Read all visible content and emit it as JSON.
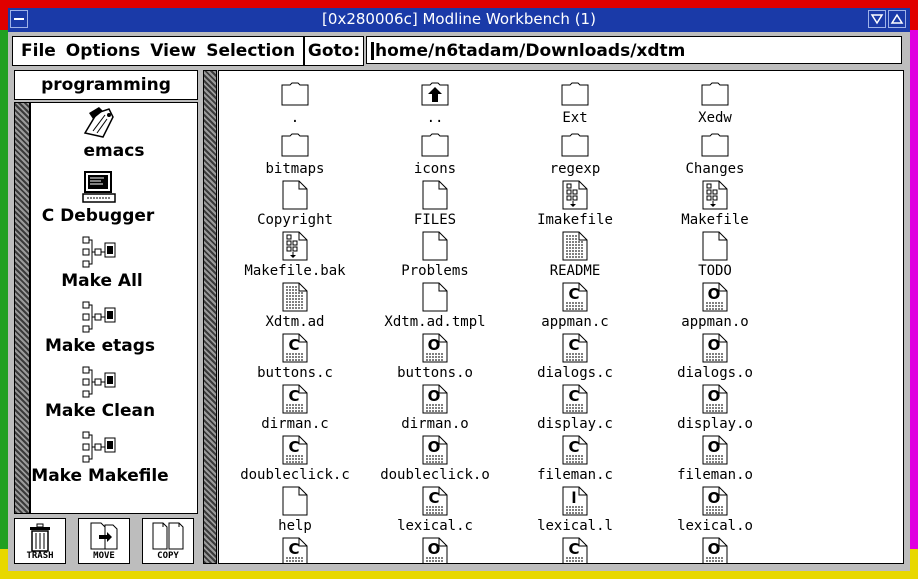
{
  "window": {
    "title": "[0x280006c] Modline Workbench (1)",
    "frame_colors": {
      "top": "#e00000",
      "bottom": "#e8d800",
      "left": "#20a020",
      "right": "#e000e0"
    }
  },
  "menubar": {
    "items": [
      "File",
      "Options",
      "View",
      "Selection"
    ]
  },
  "goto": {
    "label": "Goto:",
    "path": "home/n6tadam/Downloads/xdtm"
  },
  "tools_panel": {
    "title": "programming",
    "items": [
      {
        "label": "emacs",
        "icon": "emacs-hand-pencil-icon"
      },
      {
        "label": "C Debugger",
        "icon": "computer-terminal-icon"
      },
      {
        "label": "Make All",
        "icon": "make-tree-icon"
      },
      {
        "label": "Make etags",
        "icon": "make-tree-icon"
      },
      {
        "label": "Make Clean",
        "icon": "make-tree-icon"
      },
      {
        "label": "Make Makefile",
        "icon": "make-tree-icon"
      }
    ]
  },
  "bottom_buttons": [
    {
      "label": "TRASH",
      "icon": "trash-can-icon"
    },
    {
      "label": "MOVE",
      "icon": "move-files-icon"
    },
    {
      "label": "COPY",
      "icon": "copy-files-icon"
    }
  ],
  "files": [
    {
      "name": ".",
      "type": "folder"
    },
    {
      "name": "..",
      "type": "folder-up"
    },
    {
      "name": "Ext",
      "type": "folder"
    },
    {
      "name": "Xedw",
      "type": "folder"
    },
    {
      "name": "bitmaps",
      "type": "folder"
    },
    {
      "name": "icons",
      "type": "folder"
    },
    {
      "name": "regexp",
      "type": "folder"
    },
    {
      "name": "Changes",
      "type": "folder"
    },
    {
      "name": "Copyright",
      "type": "file"
    },
    {
      "name": "FILES",
      "type": "file"
    },
    {
      "name": "Imakefile",
      "type": "makefile"
    },
    {
      "name": "Makefile",
      "type": "makefile"
    },
    {
      "name": "Makefile.bak",
      "type": "makefile"
    },
    {
      "name": "Problems",
      "type": "file"
    },
    {
      "name": "README",
      "type": "text"
    },
    {
      "name": "TODO",
      "type": "file"
    },
    {
      "name": "Xdtm.ad",
      "type": "text"
    },
    {
      "name": "Xdtm.ad.tmpl",
      "type": "file"
    },
    {
      "name": "appman.c",
      "type": "c"
    },
    {
      "name": "appman.o",
      "type": "o"
    },
    {
      "name": "buttons.c",
      "type": "c"
    },
    {
      "name": "buttons.o",
      "type": "o"
    },
    {
      "name": "dialogs.c",
      "type": "c"
    },
    {
      "name": "dialogs.o",
      "type": "o"
    },
    {
      "name": "dirman.c",
      "type": "c"
    },
    {
      "name": "dirman.o",
      "type": "o"
    },
    {
      "name": "display.c",
      "type": "c"
    },
    {
      "name": "display.o",
      "type": "o"
    },
    {
      "name": "doubleclick.c",
      "type": "c"
    },
    {
      "name": "doubleclick.o",
      "type": "o"
    },
    {
      "name": "fileman.c",
      "type": "c"
    },
    {
      "name": "fileman.o",
      "type": "o"
    },
    {
      "name": "help",
      "type": "file"
    },
    {
      "name": "lexical.c",
      "type": "c"
    },
    {
      "name": "lexical.l",
      "type": "l"
    },
    {
      "name": "lexical.o",
      "type": "o"
    },
    {
      "name": "",
      "type": "c"
    },
    {
      "name": "",
      "type": "o"
    },
    {
      "name": "",
      "type": "c"
    },
    {
      "name": "",
      "type": "o"
    }
  ]
}
